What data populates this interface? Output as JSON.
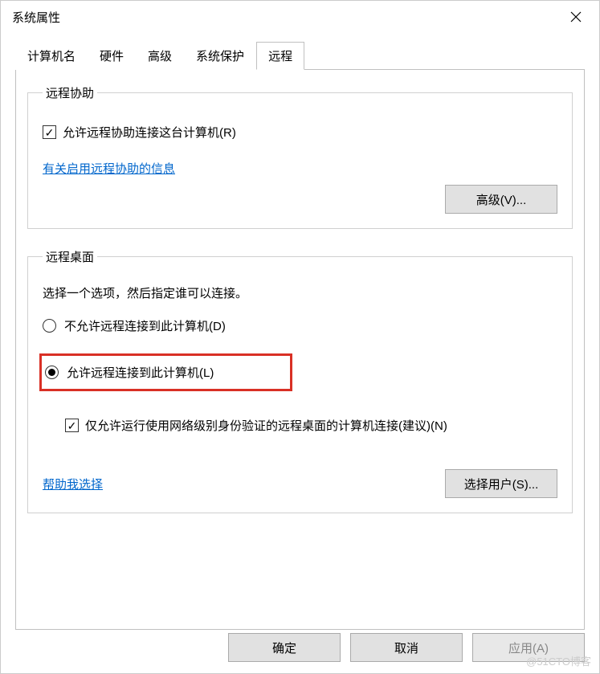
{
  "title": "系统属性",
  "tabs": {
    "computer_name": "计算机名",
    "hardware": "硬件",
    "advanced": "高级",
    "system_protection": "系统保护",
    "remote": "远程"
  },
  "remote_assist": {
    "legend": "远程协助",
    "allow_checkbox": "允许远程协助连接这台计算机(R)",
    "info_link": "有关启用远程协助的信息",
    "advanced_btn": "高级(V)..."
  },
  "remote_desktop": {
    "legend": "远程桌面",
    "instruction": "选择一个选项，然后指定谁可以连接。",
    "radio_disallow": "不允许远程连接到此计算机(D)",
    "radio_allow": "允许远程连接到此计算机(L)",
    "nla_checkbox": "仅允许运行使用网络级别身份验证的远程桌面的计算机连接(建议)(N)",
    "help_link": "帮助我选择",
    "select_users_btn": "选择用户(S)..."
  },
  "footer": {
    "ok": "确定",
    "cancel": "取消",
    "apply": "应用(A)"
  },
  "watermark": "@51CTO博客"
}
